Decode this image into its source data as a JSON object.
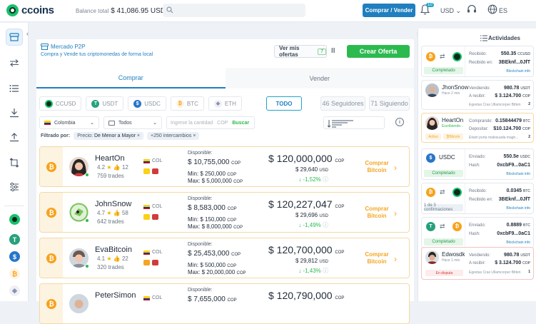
{
  "brand": {
    "name": "ccoins"
  },
  "header": {
    "balance_label": "Balance total",
    "balance_value": "$ 41,086.95 USD",
    "cta": "Comprar / Vender",
    "notif_count": "10",
    "currency": "USD",
    "language": "ES"
  },
  "p2p": {
    "title": "Mercado P2P",
    "subtitle": "Compra y Vende tus criptomonedas de forma local",
    "my_offers": "Ver mis ofertas",
    "my_offers_count": "7",
    "create": "Crear Oferta"
  },
  "tabs": [
    {
      "label": "Comprar"
    },
    {
      "label": "Vender"
    }
  ],
  "coins": [
    {
      "label": "CCUSD",
      "color": "#18c06c",
      "glyph": "●"
    },
    {
      "label": "USDT",
      "color": "#26a17b",
      "glyph": "T"
    },
    {
      "label": "USDC",
      "color": "#2775ca",
      "glyph": "$"
    },
    {
      "label": "BTC",
      "color": "#f7a21b",
      "glyph": "₿"
    },
    {
      "label": "ETH",
      "color": "#8a92b2",
      "glyph": "◆"
    }
  ],
  "coin_filters": {
    "all": "TODO",
    "following": "46 Seguidores",
    "followers": "71 Siguiendo"
  },
  "filters": {
    "country": "Colombia",
    "method": "Todos",
    "amount_placeholder": "Ingrese la cantidad",
    "amount_currency": "COP",
    "search": "Buscar"
  },
  "applied": {
    "label": "Filtrado por:",
    "tag1_key": "Precio:",
    "tag1_val": "De Menor a Mayor",
    "tag2": "+250 intercambios"
  },
  "offers": [
    {
      "name": "HeartOn",
      "rating": "4.2",
      "likes": "12",
      "trades": "759 trades",
      "country": "COL",
      "disp_label": "Disponible:",
      "available": "$ 10,755,000",
      "available_cur": "COP",
      "min": "$ 250,000",
      "max": "$ 5,000,000",
      "price": "$ 120,000,000",
      "price_cur": "COP",
      "usd": "$ 29,640",
      "pct": "-1,52%",
      "buy": "Comprar Bitcoin"
    },
    {
      "name": "JohnSnow",
      "rating": "4.7",
      "likes": "58",
      "trades": "642 trades",
      "country": "COL",
      "disp_label": "Disponible:",
      "available": "$ 8,583,000",
      "available_cur": "COP",
      "min": "$ 150,000",
      "max": "$ 8,000,000",
      "price": "$ 120,227,047",
      "price_cur": "COP",
      "usd": "$ 29,696",
      "pct": "-1,49%",
      "buy": "Comprar Bitcoin"
    },
    {
      "name": "EvaBitcoin",
      "rating": "4.1",
      "likes": "22",
      "trades": "320 trades",
      "country": "COL",
      "disp_label": "Disponible:",
      "available": "$ 25,453,000",
      "available_cur": "COP",
      "min": "$ 500,000",
      "max": "$ 20,000,000",
      "price": "$ 120,700,000",
      "price_cur": "COP",
      "usd": "$ 29,812",
      "pct": "-1,43%",
      "buy": "Comprar Bitcoin"
    },
    {
      "name": "PeterSimon",
      "rating": "",
      "likes": "",
      "trades": "",
      "country": "COL",
      "disp_label": "Disponible:",
      "available": "$ 7,655,000",
      "available_cur": "COP",
      "min": "",
      "max": "",
      "price": "$ 120,790,000",
      "price_cur": "COP",
      "usd": "",
      "pct": "",
      "buy": ""
    }
  ],
  "mm_labels": {
    "min": "Min:",
    "max": "Max:",
    "usd": "USD"
  },
  "activity": {
    "title": "Actividades",
    "items": [
      {
        "status": "Completado",
        "k1": "Recibido:",
        "v1": "550.35",
        "c1": "CCUSD",
        "k2": "Recibido en:",
        "v2": "3BEknf...0JfT",
        "link": "Blockchain info"
      },
      {
        "name": "JhonSnow",
        "sub": "Hace 2 min",
        "k1": "Vendiendo:",
        "v1": "980.78",
        "c1": "USDT",
        "k2": "A recibir:",
        "v2": "$ 3.124.700",
        "c2": "COP",
        "note": "Egestas Cras Ullamcorper Bitten",
        "count": "2"
      },
      {
        "name": "HeartOn",
        "sub": "Escribiendo...",
        "status": "Activo",
        "status2": "Bitcoin",
        "k1": "Comprando:",
        "v1": "0.15844479",
        "c1": "BTC",
        "k2": "Depositar:",
        "v2": "$10.124.700",
        "c2": "COP",
        "note": "Etiam porta malesuada magn...",
        "count": "2"
      },
      {
        "name": "USDC",
        "status": "Completado",
        "k1": "Enviado:",
        "v1": "550.5e",
        "c1": "USDC",
        "k2": "Hash:",
        "v2": "0xcbF9...0aC1",
        "link": "Blockchain info"
      },
      {
        "status": "1 de 3 confirmaciones",
        "k1": "Recibido:",
        "v1": "0.0345",
        "c1": "BTC",
        "k2": "Recibido en:",
        "v2": "3BEknf...0JfT",
        "link": "Blockchain info"
      },
      {
        "status": "Completado",
        "k1": "Enviado:",
        "v1": "0.8889",
        "c1": "BTC",
        "k2": "Hash:",
        "v2": "0xcbF9...0aC1",
        "link": "Blockchain info"
      },
      {
        "name": "Edwosdk",
        "sub": "Hace 1 min",
        "status": "En disputa",
        "k1": "Vendiendo:",
        "v1": "980.78",
        "c1": "USDT",
        "k2": "A recibir:",
        "v2": "$ 3.124.700",
        "c2": "COP",
        "note": "Egestas Cras Ullamcorper Bitten",
        "count": "1"
      }
    ]
  }
}
